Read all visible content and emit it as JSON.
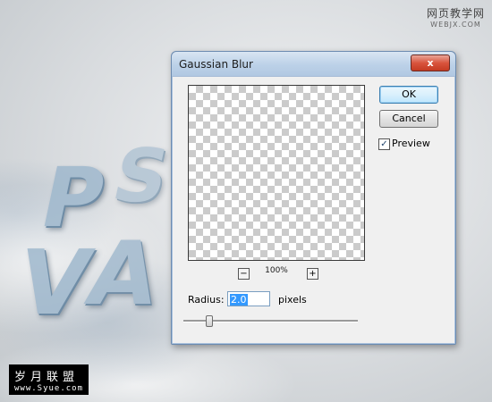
{
  "background": {
    "letters": [
      "P",
      "S",
      "V",
      "A"
    ],
    "watermark_top_right": {
      "line1": "网页教学网",
      "line2": "WEBJX.COM"
    },
    "watermark_bottom_left": {
      "line1": "岁月联盟",
      "line2": "www.Syue.com"
    }
  },
  "dialog": {
    "title": "Gaussian Blur",
    "close_glyph": "x",
    "zoom_level": "100%",
    "zoom_out_glyph": "−",
    "zoom_in_glyph": "+",
    "ok_label": "OK",
    "cancel_label": "Cancel",
    "preview_label": "Preview",
    "preview_checked": true,
    "preview_check_glyph": "✓",
    "radius_label": "Radius:",
    "radius_value": "2.0",
    "radius_unit": "pixels",
    "radius_slider_level": 0.12
  },
  "colors": {
    "titlebar": "#bcd1e8",
    "close_button": "#d9543d",
    "ok_border": "#3c7fb1",
    "selection": "#3399ff"
  }
}
